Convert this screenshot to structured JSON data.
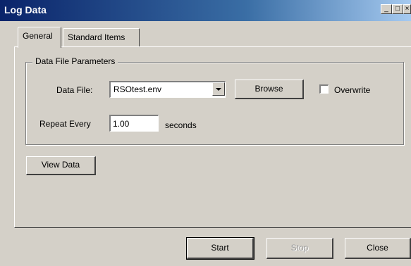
{
  "window": {
    "title": "Log Data"
  },
  "tabs": [
    {
      "label": "General",
      "active": true
    },
    {
      "label": "Standard Items",
      "active": false
    }
  ],
  "group": {
    "legend": "Data File Parameters",
    "data_file_label": "Data File:",
    "data_file_value": "RSOtest.env",
    "browse_label": "Browse",
    "overwrite_label": "Overwrite",
    "overwrite_checked": false,
    "repeat_label": "Repeat Every",
    "repeat_value": "1.00",
    "seconds_label": "seconds"
  },
  "view_data_label": "View Data",
  "footer": {
    "start_label": "Start",
    "stop_label": "Stop",
    "close_label": "Close"
  }
}
